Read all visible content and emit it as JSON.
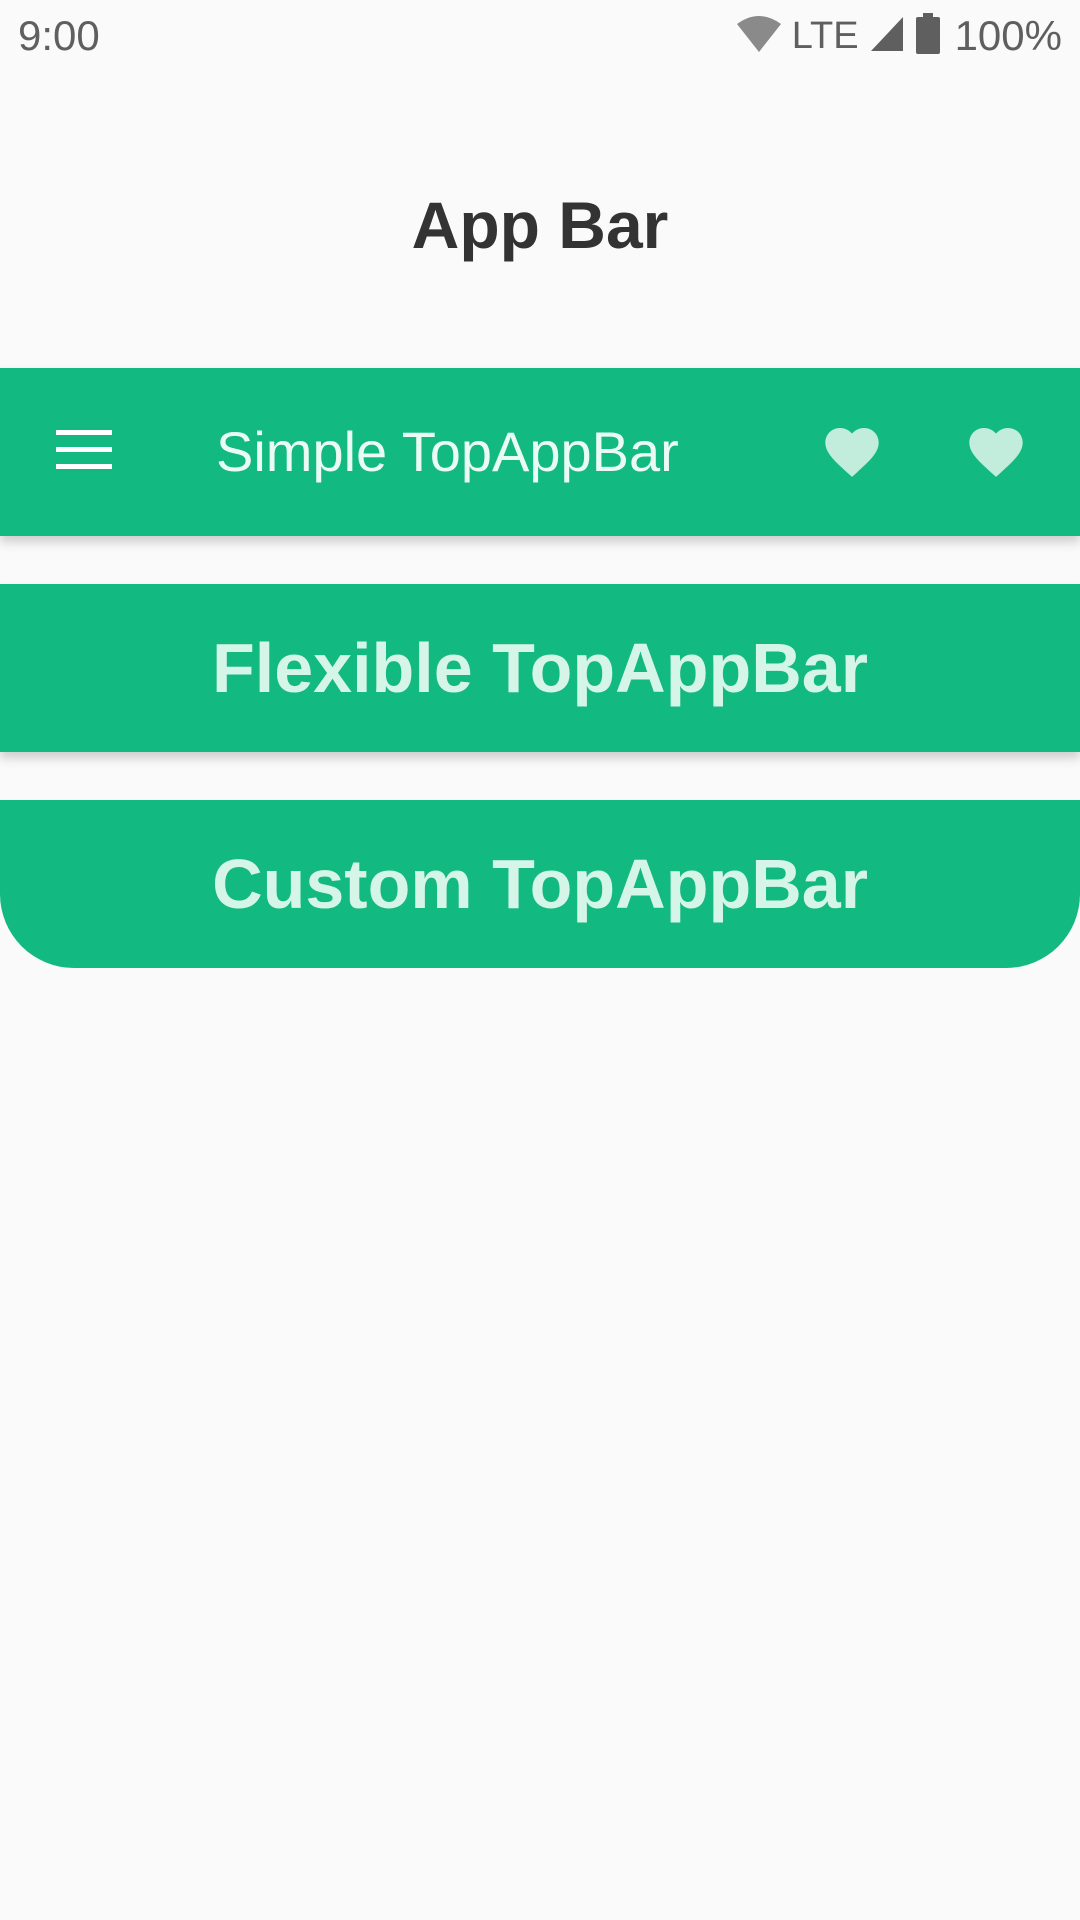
{
  "status_bar": {
    "time": "9:00",
    "network": "LTE",
    "battery": "100%",
    "icons": [
      "wifi-icon",
      "cell-signal-icon",
      "battery-icon"
    ]
  },
  "page": {
    "title": "App Bar"
  },
  "simple_bar": {
    "title": "Simple TopAppBar",
    "nav_icon": "menu-icon",
    "actions": [
      "heart-icon",
      "heart-icon"
    ]
  },
  "flexible_bar": {
    "title": "Flexible TopAppBar"
  },
  "custom_bar": {
    "title": "Custom TopAppBar"
  },
  "colors": {
    "bar_background": "#12b981",
    "bar_text": "#d6f5e9",
    "heart": "#c2ecdc",
    "page_background": "#fafafa",
    "title_text": "#333333"
  }
}
